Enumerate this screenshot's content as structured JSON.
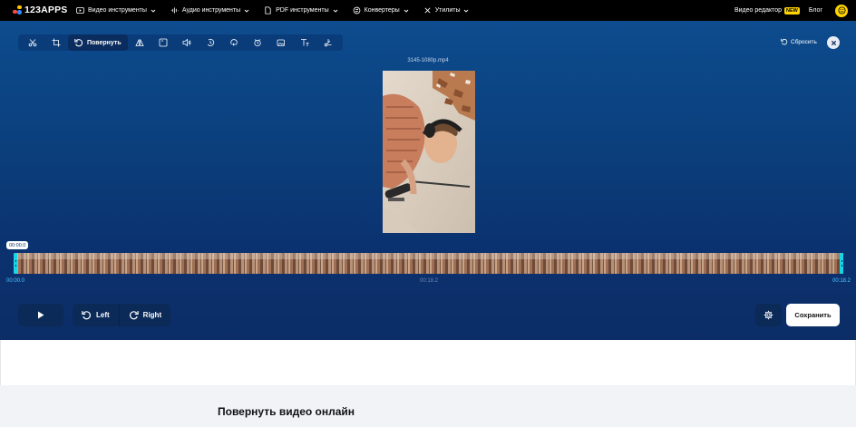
{
  "header": {
    "logo_text": "123APPS",
    "nav": [
      {
        "label": "Видео инструменты",
        "icon": "play-circle-icon"
      },
      {
        "label": "Аудио инструменты",
        "icon": "audio-wave-icon"
      },
      {
        "label": "PDF инструменты",
        "icon": "document-icon"
      },
      {
        "label": "Конвертеры",
        "icon": "convert-icon"
      },
      {
        "label": "Утилиты",
        "icon": "tools-icon"
      }
    ],
    "video_editor_label": "Видео редактор",
    "new_badge": "NEW",
    "blog_label": "Блог"
  },
  "toolbar": {
    "active_tool_label": "Повернуть",
    "tools": [
      "scissors-icon",
      "crop-icon",
      "rotate-icon",
      "flip-icon",
      "resize-icon",
      "volume-icon",
      "speed-icon",
      "loop-icon",
      "stabilize-icon",
      "add-image-icon",
      "text-icon",
      "cut-icon"
    ],
    "reset_label": "Сбросить"
  },
  "video": {
    "filename": "3145-1080p.mp4"
  },
  "timeline": {
    "current_time": "00:00.0",
    "start_time": "00:00.0",
    "mid_time": "00:18.2",
    "end_time": "00:18.2"
  },
  "controls": {
    "rotate_left_label": "Left",
    "rotate_right_label": "Right",
    "save_label": "Сохранить"
  },
  "page": {
    "heading": "Повернуть видео онлайн"
  },
  "colors": {
    "accent": "#17d4e6",
    "badge": "#ffd400",
    "editor_bg": "#0b3f7c"
  }
}
